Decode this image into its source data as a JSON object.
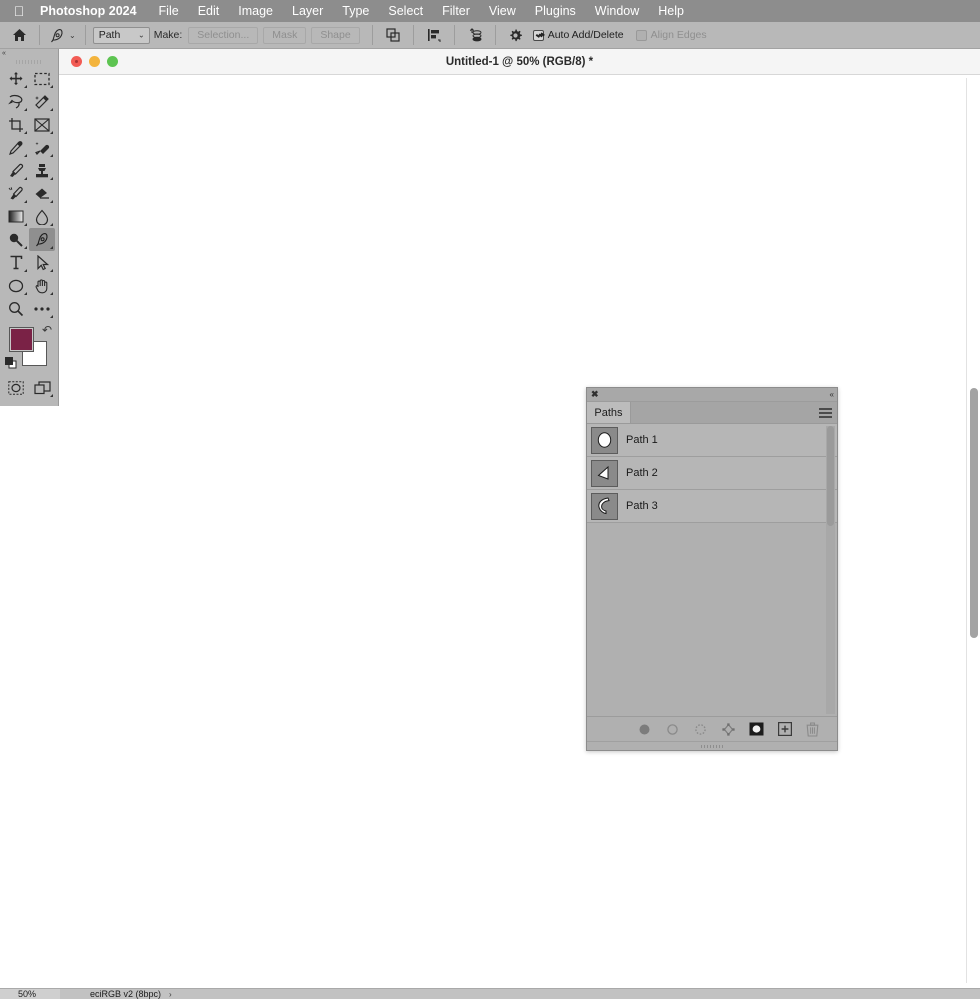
{
  "menubar": {
    "apple_icon": "apple-logo-icon",
    "app_name": "Photoshop 2024",
    "items": [
      {
        "label": "File"
      },
      {
        "label": "Edit"
      },
      {
        "label": "Image"
      },
      {
        "label": "Layer"
      },
      {
        "label": "Type"
      },
      {
        "label": "Select"
      },
      {
        "label": "Filter"
      },
      {
        "label": "View"
      },
      {
        "label": "Plugins"
      },
      {
        "label": "Window"
      },
      {
        "label": "Help"
      }
    ]
  },
  "options_bar": {
    "home_icon": "home-icon",
    "tool_icon": "pen-tool-icon",
    "tool_caret": "⌄",
    "mode_select": {
      "value": "Path",
      "caret": "⌄"
    },
    "make_label": "Make:",
    "buttons": [
      {
        "label": "Selection...",
        "name": "make-selection-button",
        "enabled": false
      },
      {
        "label": "Mask",
        "name": "make-mask-button",
        "enabled": false
      },
      {
        "label": "Shape",
        "name": "make-shape-button",
        "enabled": false
      }
    ],
    "path_operations_icon": "path-operations-icon",
    "path_alignment_icon": "path-alignment-icon",
    "path_arrangement_icon": "path-arrangement-icon",
    "gear_icon": "gear-icon",
    "auto_add_delete": {
      "label": "Auto Add/Delete",
      "checked": true
    },
    "align_edges": {
      "label": "Align Edges",
      "checked": false,
      "enabled": false
    }
  },
  "tools_panel": {
    "collapse_icon": "collapse-panel-icon",
    "grip_icon": "drag-grip-icon",
    "tools": [
      {
        "name": "move-tool",
        "icon": "move-icon",
        "active": false,
        "has_flyout": true
      },
      {
        "name": "marquee-tool",
        "icon": "rectangular-marquee-icon",
        "active": false,
        "has_flyout": true
      },
      {
        "name": "lasso-tool",
        "icon": "lasso-icon",
        "active": false,
        "has_flyout": true
      },
      {
        "name": "magic-wand-tool",
        "icon": "magic-wand-icon",
        "active": false,
        "has_flyout": true
      },
      {
        "name": "crop-tool",
        "icon": "crop-icon",
        "active": false,
        "has_flyout": true
      },
      {
        "name": "frame-tool",
        "icon": "frame-icon",
        "active": false,
        "has_flyout": true
      },
      {
        "name": "eyedropper-tool",
        "icon": "eyedropper-icon",
        "active": false,
        "has_flyout": true
      },
      {
        "name": "spot-healing-tool",
        "icon": "spot-healing-brush-icon",
        "active": false,
        "has_flyout": true
      },
      {
        "name": "brush-tool",
        "icon": "brush-icon",
        "active": false,
        "has_flyout": true
      },
      {
        "name": "clone-stamp-tool",
        "icon": "clone-stamp-icon",
        "active": false,
        "has_flyout": true
      },
      {
        "name": "history-brush-tool",
        "icon": "history-brush-icon",
        "active": false,
        "has_flyout": true
      },
      {
        "name": "eraser-tool",
        "icon": "eraser-icon",
        "active": false,
        "has_flyout": true
      },
      {
        "name": "gradient-tool",
        "icon": "gradient-icon",
        "active": false,
        "has_flyout": true
      },
      {
        "name": "blur-tool",
        "icon": "blur-droplet-icon",
        "active": false,
        "has_flyout": true
      },
      {
        "name": "dodge-tool",
        "icon": "dodge-icon",
        "active": false,
        "has_flyout": true
      },
      {
        "name": "pen-tool",
        "icon": "pen-icon",
        "active": true,
        "has_flyout": true
      },
      {
        "name": "type-tool",
        "icon": "type-icon",
        "active": false,
        "has_flyout": true
      },
      {
        "name": "path-selection-tool",
        "icon": "path-selection-arrow-icon",
        "active": false,
        "has_flyout": true
      },
      {
        "name": "shape-tool",
        "icon": "ellipse-shape-icon",
        "active": false,
        "has_flyout": true
      },
      {
        "name": "hand-tool",
        "icon": "hand-icon",
        "active": false,
        "has_flyout": true
      },
      {
        "name": "zoom-tool",
        "icon": "magnifier-icon",
        "active": false,
        "has_flyout": false
      },
      {
        "name": "edit-toolbar",
        "icon": "ellipsis-icon",
        "active": false,
        "has_flyout": true
      }
    ],
    "colors": {
      "foreground": "#7a2246",
      "background": "#ffffff",
      "swap_icon": "swap-colors-icon",
      "default_icon": "default-colors-icon"
    },
    "bottom_tools": [
      {
        "name": "quick-mask-button",
        "icon": "quick-mask-icon"
      },
      {
        "name": "screen-mode-button",
        "icon": "screen-mode-icon",
        "has_flyout": true
      }
    ]
  },
  "document": {
    "title": "Untitled-1 @ 50% (RGB/8) *",
    "window_controls": [
      {
        "name": "close-button",
        "color": "#f25b54"
      },
      {
        "name": "minimize-button",
        "color": "#f3b43d"
      },
      {
        "name": "maximize-button",
        "color": "#5dc451"
      }
    ]
  },
  "paths_panel": {
    "close_icon": "close-icon",
    "collapse_icon": "collapse-to-icons-icon",
    "tab_label": "Paths",
    "menu_icon": "panel-menu-icon",
    "rows": [
      {
        "name": "Path 1",
        "thumb": "ellipse-path-thumbnail"
      },
      {
        "name": "Path 2",
        "thumb": "triangle-path-thumbnail"
      },
      {
        "name": "Path 3",
        "thumb": "curve-path-thumbnail"
      }
    ],
    "footer_buttons": [
      {
        "name": "fill-path-button",
        "icon": "fill-path-icon"
      },
      {
        "name": "stroke-path-button",
        "icon": "stroke-path-icon"
      },
      {
        "name": "load-path-as-selection-button",
        "icon": "dashed-circle-icon"
      },
      {
        "name": "make-work-path-from-selection-button",
        "icon": "make-work-path-icon"
      },
      {
        "name": "add-layer-mask-button",
        "icon": "add-mask-icon"
      },
      {
        "name": "create-new-path-button",
        "icon": "new-path-icon"
      },
      {
        "name": "delete-path-button",
        "icon": "trash-icon"
      }
    ],
    "resize_grip_icon": "resize-grip-icon"
  },
  "status_bar": {
    "zoom": "50%",
    "color_profile": "eciRGB v2 (8bpc)",
    "expand_arrow": "›"
  },
  "scrollbars": {
    "vertical_name": "vertical-scrollbar",
    "horizontal_name": "horizontal-scrollbar"
  }
}
